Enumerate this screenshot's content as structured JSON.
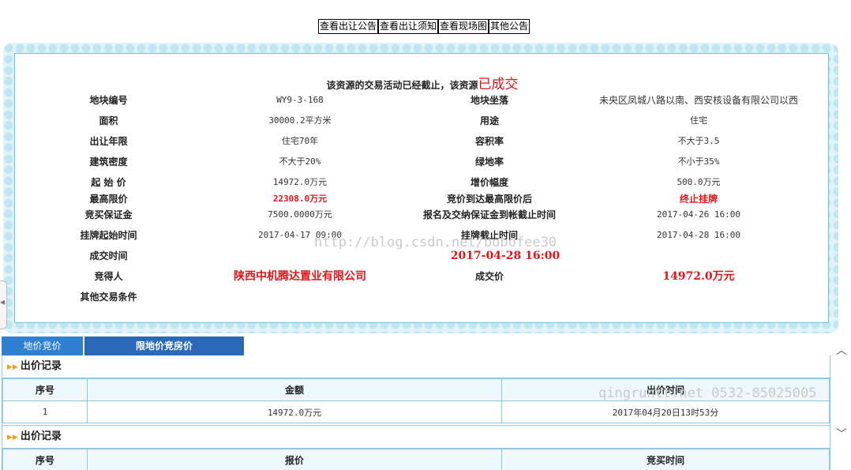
{
  "top_buttons": [
    "查看出让公告",
    "查看出让须知",
    "查看现场图",
    "其他公告"
  ],
  "result": {
    "prefix": "该资源的交易活动已经截止，该资源",
    "status": "已成交"
  },
  "details": [
    {
      "l1": "地块编号",
      "v1": "WY9-3-168",
      "l2": "地块坐落",
      "v2": "未央区凤城八路以南、西安核设备有限公司以西"
    },
    {
      "l1": "面积",
      "v1": "30000.2平方米",
      "l2": "用途",
      "v2": "住宅"
    },
    {
      "l1": "出让年限",
      "v1": "住宅70年",
      "l2": "容积率",
      "v2": "不大于3.5"
    },
    {
      "l1": "建筑密度",
      "v1": "不大于20%",
      "l2": "绿地率",
      "v2": "不小于35%"
    },
    {
      "l1": "起 始 价",
      "v1": "14972.0万元",
      "l2": "增价幅度",
      "v2": "500.0万元"
    },
    {
      "l1": "最高限价",
      "v1": "22308.0万元",
      "l2": "竞价到达最高限价后",
      "v2": "终止挂牌"
    },
    {
      "l1": "竞买保证金",
      "v1": "7500.0000万元",
      "l2": "报名及交纳保证金到帐截止时间",
      "v2": "2017-04-26 16:00"
    },
    {
      "l1": "挂牌起始时间",
      "v1": "2017-04-17 09:00",
      "l2": "挂牌截止时间",
      "v2": "2017-04-28 16:00"
    },
    {
      "l1": "成交时间",
      "v1": "",
      "l2": "2017-04-28 16:00",
      "v2": ""
    },
    {
      "l1": "竞得人",
      "v1": "陕西中机腾达置业有限公司",
      "l2": "成交价",
      "v2": "14972.0万元"
    },
    {
      "l1": "其他交易条件",
      "v1": "",
      "l2": "",
      "v2": ""
    }
  ],
  "watermarks": [
    "http://blog.csdn.net/bobofee30",
    "qingruntt.net 0532-85025005"
  ],
  "tabs": [
    "地价竞价",
    "限地价竞房价"
  ],
  "bid_records": {
    "title": "出价记录",
    "headers": [
      "序号",
      "金额",
      "出价时间"
    ],
    "rows": [
      [
        "1",
        "14972.0万元",
        "2017年04月20日13时53分"
      ]
    ]
  },
  "bid_records2": {
    "title": "出价记录",
    "headers": [
      "序号",
      "报价",
      "竞买时间"
    ]
  },
  "colors": {
    "accent_red": "#e0151b",
    "tab_blue": "#2f80d0",
    "frame_blue": "#bfe6f2"
  }
}
